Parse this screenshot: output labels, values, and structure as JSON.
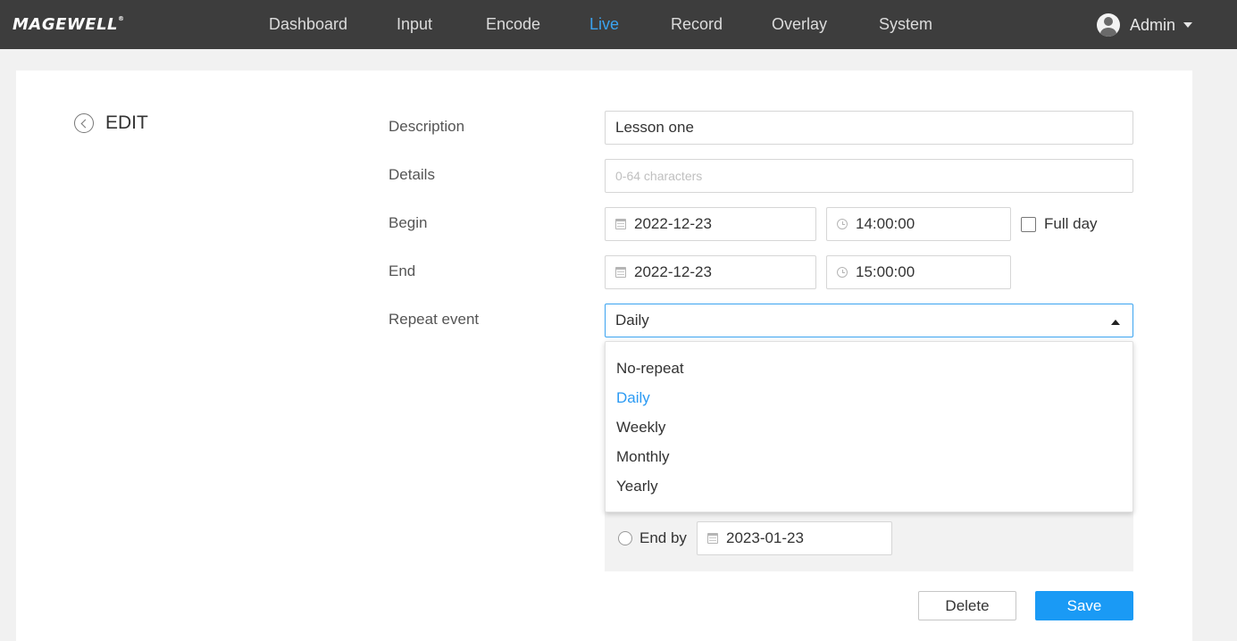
{
  "brand": {
    "logo": "MAGEWELL",
    "trademark": "®"
  },
  "nav": {
    "items": [
      {
        "label": "Dashboard",
        "active": false
      },
      {
        "label": "Input",
        "active": false
      },
      {
        "label": "Encode",
        "active": false
      },
      {
        "label": "Live",
        "active": true
      },
      {
        "label": "Record",
        "active": false
      },
      {
        "label": "Overlay",
        "active": false
      },
      {
        "label": "System",
        "active": false
      }
    ],
    "user": "Admin"
  },
  "page": {
    "title": "EDIT"
  },
  "form": {
    "description": {
      "label": "Description",
      "value": "Lesson one"
    },
    "details": {
      "label": "Details",
      "value": "",
      "placeholder": "0-64 characters"
    },
    "begin": {
      "label": "Begin",
      "date": "2022-12-23",
      "time": "14:00:00",
      "full_day_label": "Full day",
      "full_day_checked": false
    },
    "end": {
      "label": "End",
      "date": "2022-12-23",
      "time": "15:00:00"
    },
    "repeat": {
      "label": "Repeat event",
      "selected": "Daily",
      "options": [
        "No-repeat",
        "Daily",
        "Weekly",
        "Monthly",
        "Yearly"
      ],
      "end_by_label": "End by",
      "end_by_date": "2023-01-23"
    }
  },
  "actions": {
    "delete": "Delete",
    "save": "Save"
  },
  "colors": {
    "accent": "#3aa3f0",
    "topbar": "#3d3d3d",
    "save_button": "#1a9af5"
  }
}
